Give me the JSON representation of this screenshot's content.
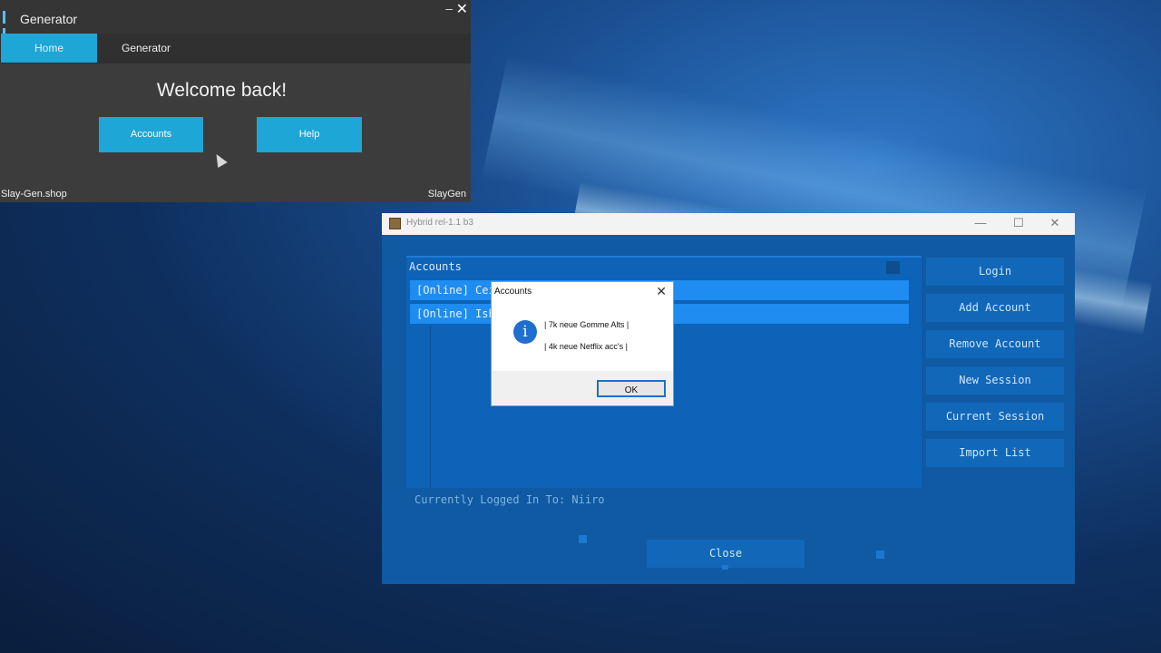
{
  "generator": {
    "title": "Generator",
    "min_glyph": "–",
    "close_glyph": "✕",
    "tabs": [
      {
        "label": "Home"
      },
      {
        "label": "Generator"
      }
    ],
    "welcome": "Welcome back!",
    "buttons": {
      "accounts": "Accounts",
      "help": "Help"
    },
    "footer_left": "Slay-Gen.shop",
    "footer_right": "SlayGen",
    "accent_color": "#1ea6d6"
  },
  "hybrid": {
    "title": "Hybrid rel-1.1 b3",
    "controls": {
      "min": "—",
      "max": "☐",
      "close": "✕"
    },
    "accounts_header": "Accounts",
    "accounts": [
      {
        "label": "[Online] Ceir"
      },
      {
        "label": "[Online] Ishu"
      }
    ],
    "buttons": {
      "login": "Login",
      "add_account": "Add Account",
      "remove_account": "Remove Account",
      "new_session": "New Session",
      "current_session": "Current Session",
      "import_list": "Import List",
      "close": "Close"
    },
    "status": "Currently Logged In To: Niiro"
  },
  "dialog": {
    "title": "Accounts",
    "close_glyph": "✕",
    "icon": "info-icon",
    "icon_glyph": "i",
    "line1": "| 7k neue Gomme Alts |",
    "line2": "| 4k neue Netflix acc's |",
    "ok": "OK"
  }
}
